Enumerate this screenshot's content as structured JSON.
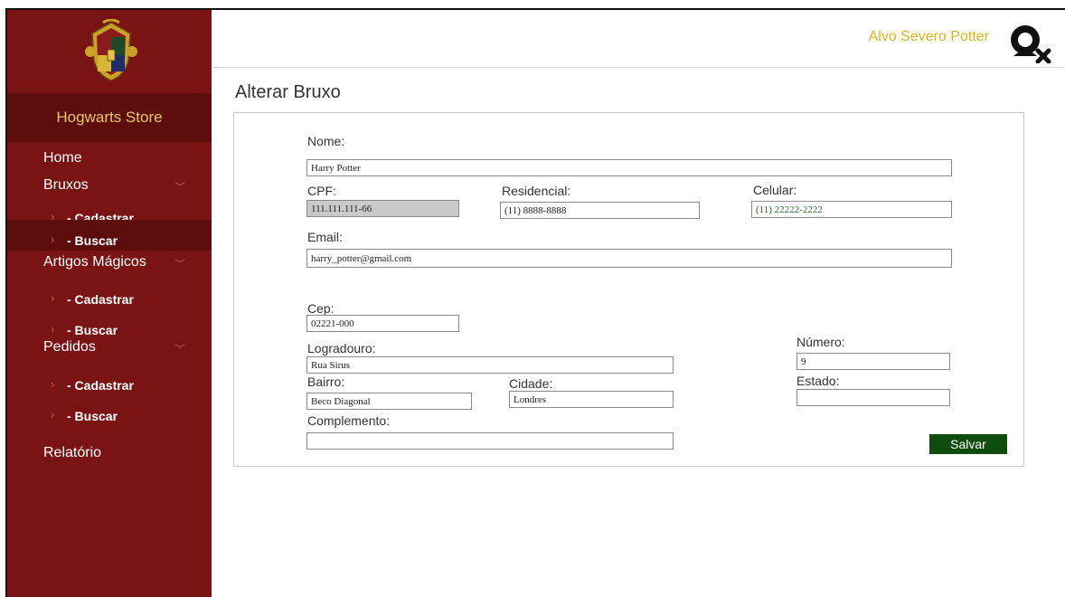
{
  "sidebar": {
    "store_title": "Hogwarts Store",
    "nav": {
      "home": "Home",
      "bruxos": "Bruxos",
      "bruxos_cadastrar": "- Cadastrar",
      "bruxos_buscar": "- Buscar",
      "artigos": "Artigos Mágicos",
      "artigos_cadastrar": "- Cadastrar",
      "artigos_buscar": "- Buscar",
      "pedidos": "Pedidos",
      "pedidos_cadastrar": "- Cadastrar",
      "pedidos_buscar": "- Buscar",
      "relatorio": "Relatório"
    },
    "chevron_glyph": "﹀",
    "sub_chevron_glyph": "›"
  },
  "header": {
    "user_name": "Alvo Severo Potter"
  },
  "page": {
    "title": "Alterar Bruxo"
  },
  "form": {
    "nome": {
      "label": "Nome:",
      "value": "Harry Potter"
    },
    "cpf": {
      "label": "CPF:",
      "value": "111.111.111-66"
    },
    "residencial": {
      "label": "Residencial:",
      "value": "(11) 8888-8888"
    },
    "celular": {
      "label": "Celular:",
      "value": "(11) 22222-2222"
    },
    "email": {
      "label": "Email:",
      "value": "harry_potter@gmail.com"
    },
    "cep": {
      "label": "Cep:",
      "value": "02221-000"
    },
    "logradouro": {
      "label": "Logradouro:",
      "value": "Rua Sirus"
    },
    "numero": {
      "label": "Número:",
      "value": "9"
    },
    "bairro": {
      "label": "Bairro:",
      "value": "Beco Diagonal"
    },
    "cidade": {
      "label": "Cidade:",
      "value": "Londres"
    },
    "estado": {
      "label": "Estado:",
      "value": ""
    },
    "complemento": {
      "label": "Complemento:",
      "value": ""
    },
    "save_label": "Salvar"
  },
  "colors": {
    "sidebar_bg": "#7a1414",
    "sidebar_active": "#5e0d0d",
    "accent_gold": "#e3b21b",
    "save_button": "#0f4d0f"
  },
  "icons": {
    "crest": "hogwarts-crest-icon",
    "user": "user-remove-icon"
  }
}
